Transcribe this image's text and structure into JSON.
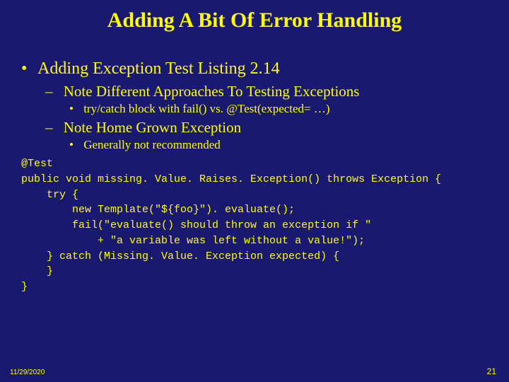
{
  "title": "Adding A Bit Of Error Handling",
  "b1": "Adding Exception Test Listing 2.14",
  "b1_1": "Note Different Approaches To Testing Exceptions",
  "b1_1_1": "try/catch block with fail() vs. @Test(expected= …)",
  "b1_2": "Note Home Grown Exception",
  "b1_2_1": "Generally not recommended",
  "code": "@Test\npublic void missing. Value. Raises. Exception() throws Exception {\n    try {\n        new Template(\"${foo}\"). evaluate();\n        fail(\"evaluate() should throw an exception if \"\n            + \"a variable was left without a value!\");\n    } catch (Missing. Value. Exception expected) {\n    }\n}",
  "footer_date": "11/29/2020",
  "footer_page": "21"
}
